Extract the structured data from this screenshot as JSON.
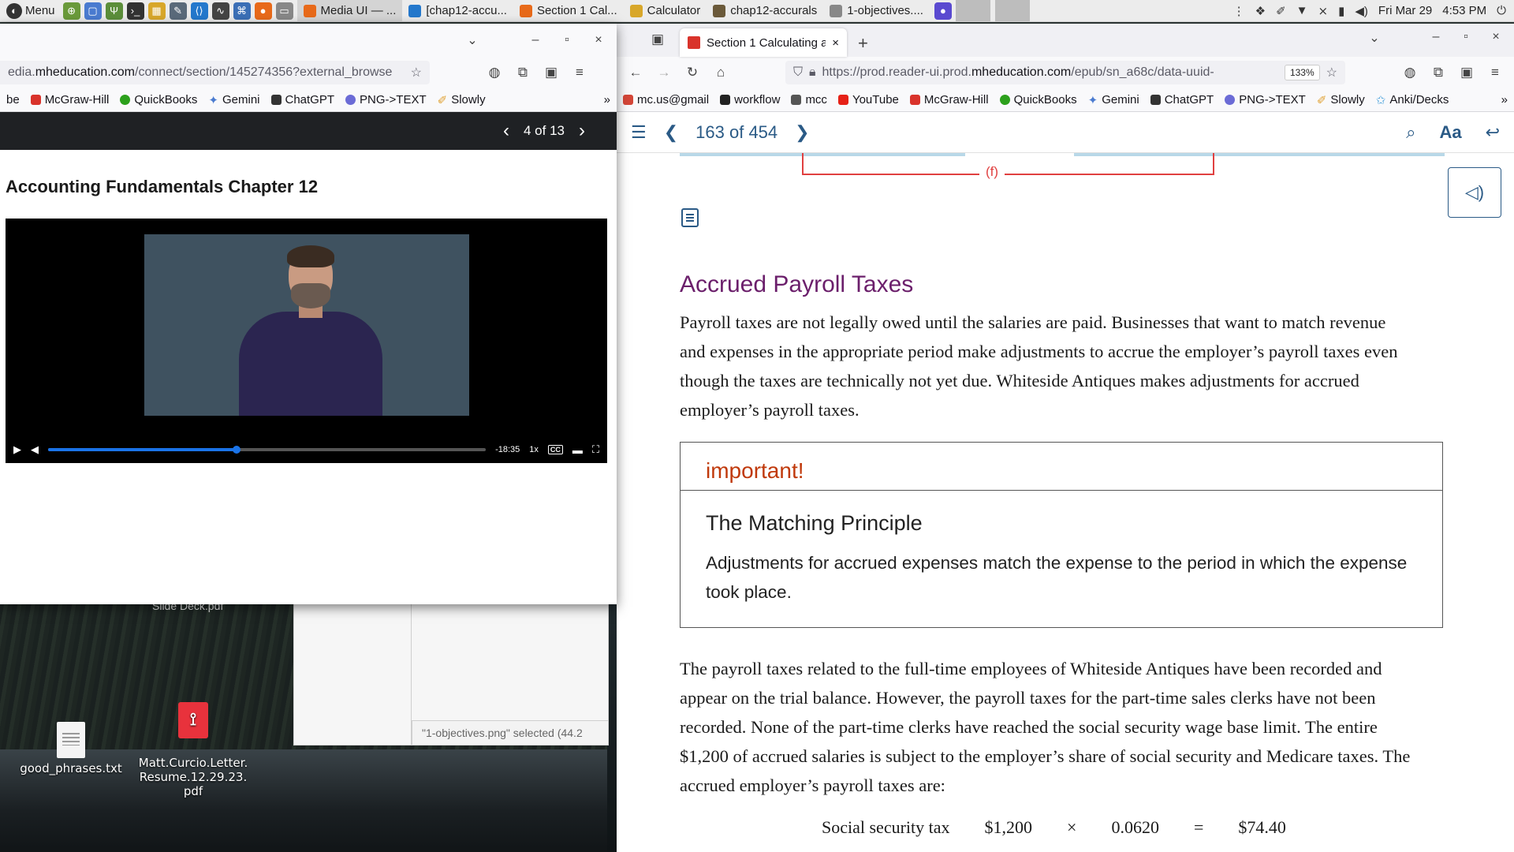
{
  "panel": {
    "menu_label": "Menu",
    "tasks": [
      {
        "label": "Media UI — ...",
        "active": true
      },
      {
        "label": "[chap12-accu...",
        "active": false
      },
      {
        "label": "Section 1 Cal...",
        "active": false
      },
      {
        "label": "Calculator",
        "active": false
      },
      {
        "label": "chap12-accurals",
        "active": false
      },
      {
        "label": "1-objectives....",
        "active": false
      }
    ],
    "date": "Fri Mar 29",
    "time": "4:53 PM"
  },
  "left_browser": {
    "url_prefix": "edia.",
    "url_domain": "mheducation.com",
    "url_path": "/connect/section/145274356?external_browse",
    "bookmarks": [
      "be",
      "McGraw-Hill",
      "QuickBooks",
      "Gemini",
      "ChatGPT",
      "PNG->TEXT",
      "Slowly"
    ],
    "pager": "4 of 13",
    "course_title": "Accounting Fundamentals Chapter 12",
    "video": {
      "time_remaining": "-18:35",
      "speed": "1x",
      "cc": "CC",
      "progress": 0.43
    }
  },
  "right_browser": {
    "tab_title": "Section 1 Calculating a",
    "url_prefix": "https://prod.reader-ui.prod.",
    "url_domain": "mheducation.com",
    "url_path": "/epub/sn_a68c/data-uuid-",
    "zoom": "133%",
    "bookmarks": [
      "mc.us@gmail",
      "workflow",
      "mcc",
      "YouTube",
      "McGraw-Hill",
      "QuickBooks",
      "Gemini",
      "ChatGPT",
      "PNG->TEXT",
      "Slowly",
      "Anki/Decks"
    ],
    "page_indicator": "163 of 454",
    "font_button": "Aa",
    "figure_label": "(f)",
    "section_heading": "Accrued Payroll Taxes",
    "para1": "Payroll taxes are not legally owed until the salaries are paid. Businesses that want to match revenue and expenses in the appropriate period make adjustments to accrue the employer’s payroll taxes even though the taxes are technically not yet due. Whiteside Antiques makes adjustments for accrued employer’s payroll taxes.",
    "important": {
      "label": "important!",
      "title": "The Matching Principle",
      "body": "Adjustments for accrued expenses match the expense to the period in which the expense took place."
    },
    "para2": "The payroll taxes related to the full-time employees of Whiteside Antiques have been recorded and appear on the trial balance. However, the payroll taxes for the part-time sales clerks have not been recorded. None of the part-time clerks have reached the social security wage base limit. The entire $1,200 of accrued salaries is subject to the employer’s share of social security and Medicare taxes. The accrued employer’s payroll taxes are:",
    "calc_row": [
      "Social security tax",
      "$1,200",
      "×",
      "0.0620",
      "=",
      "$74.40"
    ]
  },
  "desktop": {
    "icons": [
      {
        "label": "good_phrases.txt"
      },
      {
        "label": "Matt.Curcio.Letter.\nResume.12.29.23.\npdf"
      }
    ],
    "partial_label": "Slide Deck.pdf",
    "file_status": "\"1-objectives.png\" selected (44.2"
  }
}
